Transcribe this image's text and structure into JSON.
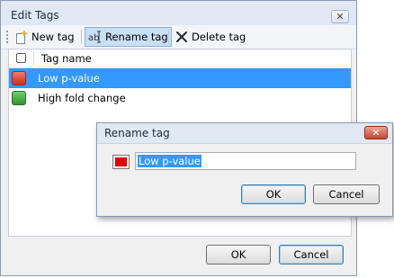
{
  "window": {
    "title": "Edit Tags",
    "close_glyph": "✕"
  },
  "toolbar": {
    "new_tag": "New tag",
    "rename_tag": "Rename tag",
    "delete_tag": "Delete tag"
  },
  "list": {
    "column_name": "Tag name",
    "rows": [
      {
        "name": "Low p-value",
        "color": "#e03a2a",
        "selected": true
      },
      {
        "name": "High fold change",
        "color": "#3aa33a",
        "selected": false
      }
    ]
  },
  "footer": {
    "ok": "OK",
    "cancel": "Cancel"
  },
  "rename_dialog": {
    "title": "Rename tag",
    "close_glyph": "✕",
    "color": "#e00000",
    "value": "Low p-value",
    "ok": "OK",
    "cancel": "Cancel"
  },
  "colors": {
    "selection": "#3399ff",
    "title_bar": "#dfe8f3"
  }
}
